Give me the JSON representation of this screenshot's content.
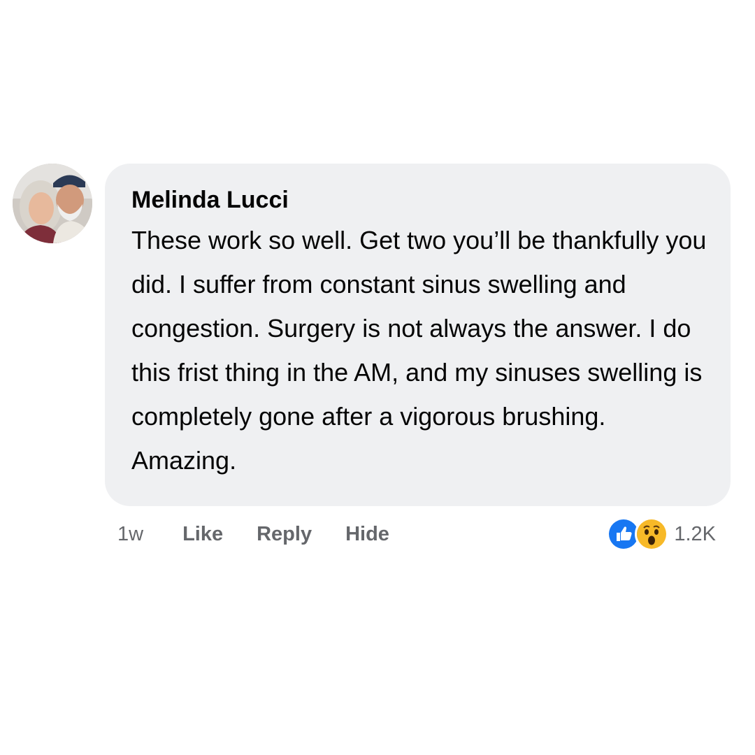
{
  "comment": {
    "author": "Melinda Lucci",
    "text": "These work so well. Get two you’ll be thankfully you did. I suffer from constant sinus swelling and congestion. Surgery is not always the answer. I do this frist thing in the AM, and my sinuses swelling is completely gone after a vigorous brushing. Amazing.",
    "timestamp": "1w",
    "actions": {
      "like": "Like",
      "reply": "Reply",
      "hide": "Hide"
    },
    "reactions": {
      "icons": [
        "like-reaction-icon",
        "wow-reaction-icon"
      ],
      "count": "1.2K"
    }
  },
  "colors": {
    "bubble_background": "#eff0f2",
    "text": "#050505",
    "secondary_text": "#65676b",
    "like_blue": "#1877f2",
    "wow_yellow": "#f7b928"
  }
}
